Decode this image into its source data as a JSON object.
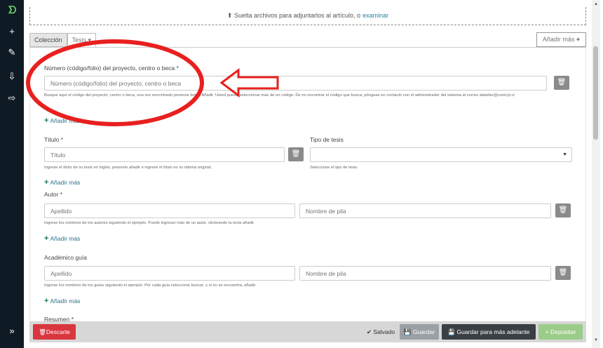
{
  "sidebar": {
    "logo": "ᗤ",
    "items": [
      {
        "icon": "plus-icon",
        "glyph": "+"
      },
      {
        "icon": "pencil-icon",
        "glyph": "✎"
      },
      {
        "icon": "import-icon",
        "glyph": "⇩"
      },
      {
        "icon": "export-icon",
        "glyph": "⇨"
      }
    ],
    "expand": "»"
  },
  "dropzone": {
    "text": "Suelta archivos para adjuntarlos al artículo, o",
    "link": "examinar"
  },
  "tabs": {
    "coleccion": "Colección",
    "tesis": "Tesis ▾"
  },
  "add_more_top": "Añadir más",
  "project_number": {
    "label": "Número (código/folio) del proyecto, centro o beca *",
    "placeholder": "Número (código/folio) del proyecto, centro o beca",
    "help": "Busque aquí el código del proyecto, centro o beca, una vez encontrado presione botón Añadir. Usted puede seleccionar más de un código. De no encontrar el código que busca, póngase en contacto con el administrador del sistema al correo alatelier@conicyt.cl",
    "add_more": "Añadir más"
  },
  "title": {
    "label": "Título *",
    "placeholder": "Título",
    "help": "Ingrese el título de su tesis en inglés, presione añadir e ingrese el título en su idioma original.",
    "add_more": "Añadir más"
  },
  "thesis_type": {
    "label": "Tipo de tesis",
    "value": "",
    "help": "Seleccione el tipo de tesis."
  },
  "author": {
    "label": "Autor *",
    "surname_placeholder": "Apellido",
    "name_placeholder": "Nombre de pila",
    "help": "Ingrese los nombres de los autores siguiendo el ejemplo. Puede ingresar más de un autor, clickeando la tecla añadir.",
    "add_more": "Añadir más"
  },
  "advisor": {
    "label": "Académico guía",
    "surname_placeholder": "Apellido",
    "name_placeholder": "Nombre de pila",
    "help": "Ingrese los nombres de los guías siguiendo el ejemplo. Por cada guía seleccione buscar, y si no se encuentra, añadir.",
    "add_more": "Añadir más"
  },
  "summary": {
    "label": "Resumen *"
  },
  "footer": {
    "discard": "Descarte",
    "saved": "Salvado",
    "save": "Guardar",
    "save_later": "Guardar para más adelante",
    "deposit": "Depositar"
  },
  "colors": {
    "sidebar": "#0f1b24",
    "discard": "#d9363e",
    "deposit": "#9ccc8a",
    "dark_button": "#3a3f44",
    "annotation": "#e8201f"
  }
}
